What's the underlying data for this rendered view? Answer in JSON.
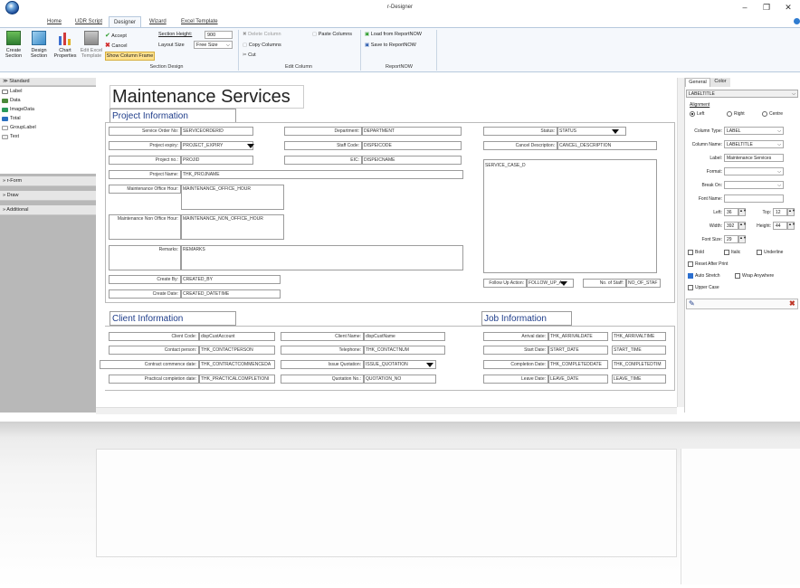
{
  "window": {
    "title": "r-Designer",
    "minimize": "–",
    "maximize": "❐",
    "close": "✕"
  },
  "tabs": [
    "Home",
    "UDR Script",
    "Designer",
    "Wizard",
    "Excel Template"
  ],
  "ribbon": {
    "create_section": "Create Section",
    "design_section": "Design Section",
    "chart_properties": "Chart Properties",
    "edit_excel_template": "Edit Excel Template",
    "accept": "Accept",
    "cancel": "Cancel",
    "show_column_frame": "Show Column Frame",
    "section_height_label": "Section Height:",
    "section_height_value": "900",
    "layout_size_label": "Layout Size",
    "layout_size_value": "Free Size",
    "delete_column": "Delete Column",
    "paste_columns": "Paste Columns",
    "copy_columns": "Copy Columns",
    "cut": "Cut",
    "load_from_reportnow": "Load from ReportNOW",
    "save_to_reportnow": "Save to ReportNOW",
    "group_section_design": "Section Design",
    "group_edit_column": "Edit Column",
    "group_reportnow": "ReportNOW"
  },
  "left_panel": {
    "standard": "Standard",
    "items": [
      "Label",
      "Data",
      "ImageData",
      "Total",
      "GroupLabel",
      "Text"
    ],
    "rform": "r-Form",
    "draw": "Draw",
    "additional": "Additional"
  },
  "canvas": {
    "title": "Maintenance Services",
    "project_info": "Project Information",
    "client_info": "Client Information",
    "job_info": "Job Information",
    "fields": {
      "service_order_no": {
        "label": "Service Order No:",
        "value": "SERVICEORDERID"
      },
      "project_expiry": {
        "label": "Project expiry:",
        "value": "PROJECT_EXPIRY"
      },
      "project_no": {
        "label": "Project no.:",
        "value": "PROJID"
      },
      "project_name": {
        "label": "Project Name:",
        "value": "THK_PROJNAME"
      },
      "maint_office": {
        "label": "Maintenance Office Hour:",
        "value": "MAINTENANCE_OFFICE_HOUR"
      },
      "maint_non_office": {
        "label": "Maintenance Non Office Hour:",
        "value": "MAINTENANCE_NON_OFFICE_HOUR"
      },
      "remarks": {
        "label": "Remarks:",
        "value": "REMARKS"
      },
      "create_by": {
        "label": "Create By:",
        "value": "CREATED_BY"
      },
      "create_date": {
        "label": "Create Date:",
        "value": "CREATED_DATETIME"
      },
      "department": {
        "label": "Department:",
        "value": "DEPARTMENT"
      },
      "staff_code": {
        "label": "Staff Code:",
        "value": "DISPEICODE"
      },
      "eic": {
        "label": "EIC:",
        "value": "DISPEICNAME"
      },
      "status": {
        "label": "Status:",
        "value": "STATUS"
      },
      "cancel_desc": {
        "label": "Cancel Description:",
        "value": "CANCEL_DESCRIPTION"
      },
      "service_case": {
        "value": "SERVICE_CASE_D"
      },
      "follow_up": {
        "label": "Follow Up Action:",
        "value": "FOLLOW_UP_A"
      },
      "no_of_staff": {
        "label": "No. of Staff:",
        "value": "NO_OF_STAF"
      },
      "client_code": {
        "label": "Client Code:",
        "value": "dispCustAccount"
      },
      "contact_person": {
        "label": "Contact person:",
        "value": "THK_CONTACTPERSON"
      },
      "contract_commence": {
        "label": "Contract commence date:",
        "value": "THK_CONTRACTCOMMENCEDA"
      },
      "practical_completion": {
        "label": "Practical completion date:",
        "value": "THK_PRACTICALCOMPLETIONI"
      },
      "client_name": {
        "label": "Client Name:",
        "value": "dispCustName"
      },
      "telephone": {
        "label": "Telephone:",
        "value": "THK_CONTACTNUM"
      },
      "issue_quotation": {
        "label": "Issue Quotation:",
        "value": "ISSUE_QUOTATION"
      },
      "quotation_no": {
        "label": "Quotation No.:",
        "value": "QUOTATION_NO"
      },
      "arrival_date": {
        "label": "Arrival date:",
        "value": "THK_ARRIVALDATE",
        "value2": "THK_ARRIVALTIME"
      },
      "start_date": {
        "label": "Start Date:",
        "value": "START_DATE",
        "value2": "START_TIME"
      },
      "completion_date": {
        "label": "Completion Date:",
        "value": "THK_COMPLETEDDATE",
        "value2": "THK_COMPLETEDTIM"
      },
      "leave_date": {
        "label": "Leave Date:",
        "value": "LEAVE_DATE",
        "value2": "LEAVE_TIME"
      }
    }
  },
  "right_panel": {
    "tab_general": "General",
    "tab_color": "Color",
    "component": "LABELTITLE",
    "alignment": "Alignment",
    "align_left": "Left",
    "align_right": "Right",
    "align_centre": "Centre",
    "column_type_label": "Column Type:",
    "column_type_value": "LABEL",
    "column_name_label": "Column Name:",
    "column_name_value": "LABELTITLE",
    "label_label": "Label:",
    "label_value": "Maintenance Services",
    "format_label": "Format:",
    "break_on_label": "Break On:",
    "font_name_label": "Font Name:",
    "left_label": "Left:",
    "left_value": "36",
    "top_label": "Top:",
    "top_value": "12",
    "width_label": "Width:",
    "width_value": "392",
    "height_label": "Height:",
    "height_value": "44",
    "font_size_label": "Font Size:",
    "font_size_value": "29",
    "bold": "Bold",
    "italic": "Italic",
    "underline": "Underline",
    "reset_after_print": "Reset After Print",
    "auto_stretch": "Auto Stretch",
    "wrap_anywhere": "Wrap Anywhere",
    "upper_case": "Upper Case"
  }
}
